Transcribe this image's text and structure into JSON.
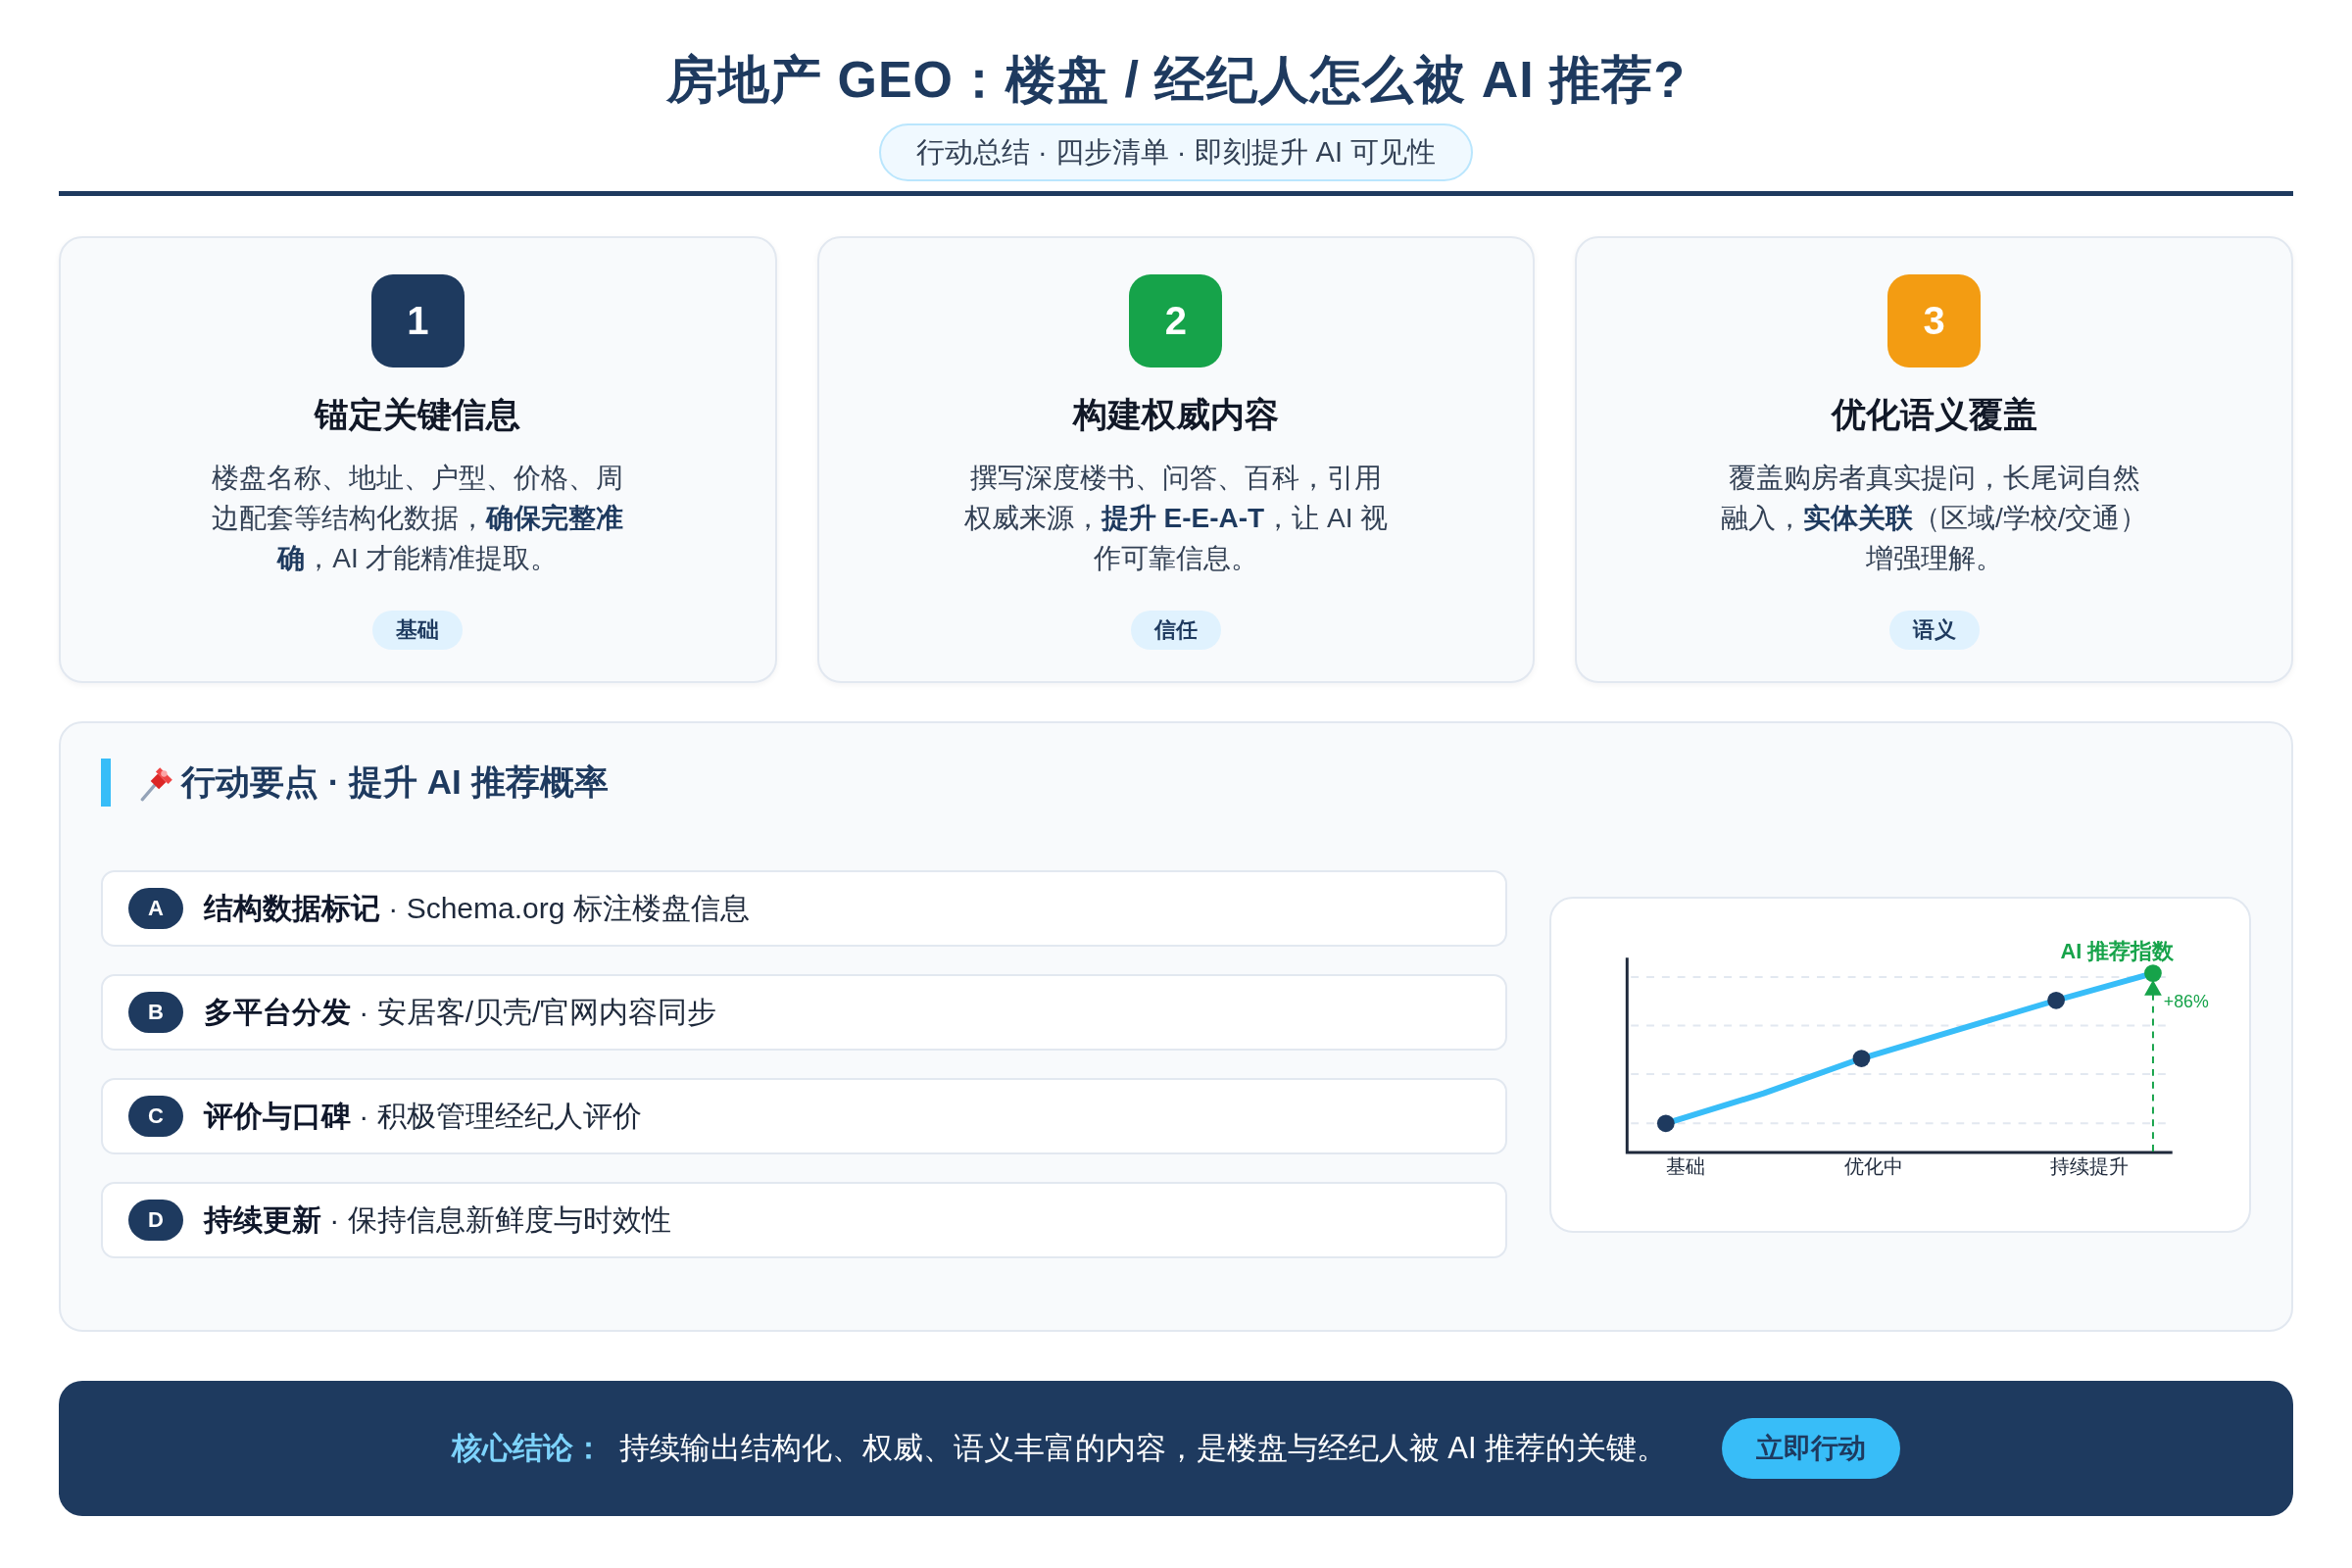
{
  "title": "房地产 GEO：楼盘 / 经纪人怎么被 AI 推荐?",
  "subtitle": "行动总结 · 四步清单 · 即刻提升 AI 可见性",
  "cards": [
    {
      "number": "1",
      "color": "#1e3a5f",
      "title": "锚定关键信息",
      "description": "楼盘名称、地址、户型、价格、周边配套等结构化数据，**确保完整准确**，AI 才能精准提取。",
      "tag": "基础"
    },
    {
      "number": "2",
      "color": "#16a34a",
      "title": "构建权威内容",
      "description": "撰写深度楼书、问答、百科，引用权威来源，**提升 E-E-A-T**，让 AI 视作可靠信息。",
      "tag": "信任"
    },
    {
      "number": "3",
      "color": "#f39c12",
      "title": "优化语义覆盖",
      "description": "覆盖购房者真实提问，长尾词自然融入，**实体关联**（区域/学校/交通）增强理解。",
      "tag": "语义"
    }
  ],
  "actions": {
    "title": "行动要点 · 提升 AI 推荐概率",
    "items": [
      {
        "letter": "A",
        "text": "**结构数据标记** · Schema.org 标注楼盘信息"
      },
      {
        "letter": "B",
        "text": "**多平台分发** · 安居客/贝壳/官网内容同步"
      },
      {
        "letter": "C",
        "text": "**评价与口碑** · 积极管理经纪人评价"
      },
      {
        "letter": "D",
        "text": "**持续更新** · 保持信息新鲜度与时效性"
      }
    ]
  },
  "chart": {
    "series_label": "AI 推荐指数",
    "change": "+86%",
    "x_labels": [
      "基础",
      "优化中",
      "持续提升"
    ]
  },
  "conclusion": {
    "label": "核心结论：",
    "text": "持续输出结构化、权威、语义丰富的内容，是楼盘与经纪人被 AI 推荐的关键。",
    "button": "立即行动"
  }
}
